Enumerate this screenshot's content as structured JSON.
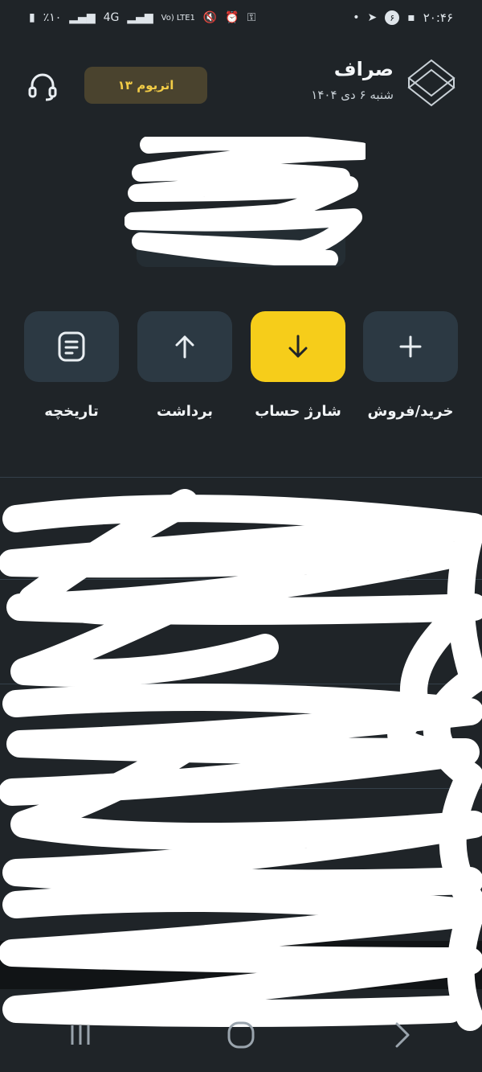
{
  "status_bar": {
    "time": "۲۰:۴۶",
    "notification_count": "۶",
    "battery": "٪۱۰",
    "network": "4G",
    "lte": "Vo) LTE1"
  },
  "header": {
    "brand_name": "صراف",
    "date": "شنبه ۶ دی ۱۴۰۴",
    "badge_label": "۱۳ اتریوم"
  },
  "actions": [
    {
      "label": "خرید/فروش",
      "icon": "plus-icon"
    },
    {
      "label": "شارژ حساب",
      "icon": "arrow-down-icon"
    },
    {
      "label": "برداشت",
      "icon": "arrow-up-icon"
    },
    {
      "label": "تاریخچه",
      "icon": "document-icon"
    }
  ],
  "colors": {
    "background": "#1f2428",
    "tile": "#2c3943",
    "accent_yellow": "#f6cd1a",
    "badge_bg": "#4a432e",
    "badge_text": "#f2cc46",
    "positive": "#22c58b"
  },
  "nav": {
    "items": [
      "recent-apps-icon",
      "home-icon",
      "back-icon"
    ]
  }
}
